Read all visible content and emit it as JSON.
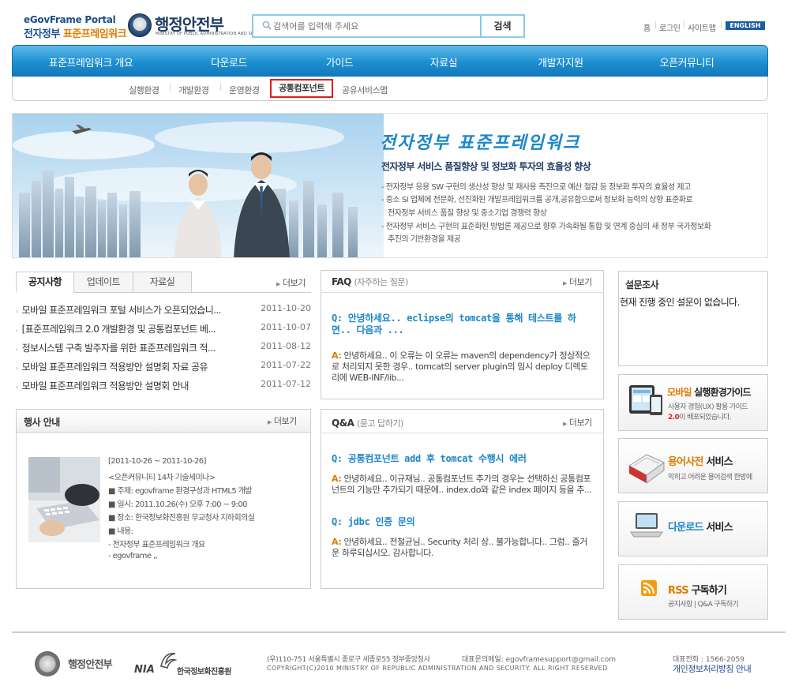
{
  "header": {
    "logo_en": "eGovFrame Portal",
    "logo_kr_prefix": "전자정부",
    "logo_kr_highlight": "표준프레임워크",
    "ministry": "행정안전부",
    "ministry_en": "MINISTRY OF PUBLIC ADMINISTRATION AND SECURITY",
    "search_placeholder": "검색어를 입력해 주세요",
    "search_button": "검색",
    "util_links": [
      "홈",
      "로그인",
      "사이트맵"
    ],
    "english_button": "ENGLISH"
  },
  "nav": {
    "main": [
      "표준프레임워크 개요",
      "다운로드",
      "가이드",
      "자료실",
      "개발자지원",
      "오픈커뮤니티"
    ],
    "sub": [
      "실행환경",
      "개발환경",
      "운영환경",
      "공통컴포넌트",
      "공유서비스맵"
    ],
    "sub_active_index": 3
  },
  "banner": {
    "title": "전자정부 표준프레임워크",
    "subtitle": "전자정부 서비스 품질향상 및 정보화 투자의 효율성 향상",
    "lines": [
      "- 전자정부 응용 SW 구현의 생산성 향상 및 재사용 촉진으로 예산 절감 등 정보화 투자의 효율성 제고",
      "- 중소 SI 업체에 전문화, 선진화된 개발프레임워크를 공개,공유함으로써 정보화 능력의 상향 표준화로",
      "  전자정부 서비스 품질 향상 및 중소기업 경쟁력 향상",
      "- 전자정부 서비스 구현의 표준화된 방법론 제공으로 향후 가속화될 통합 및 연계 중심의 새 정부 국가정보화",
      "  추진의 기반환경을 제공"
    ]
  },
  "notice": {
    "tabs": [
      "공지사항",
      "업데이트",
      "자료실"
    ],
    "more": "더보기",
    "items": [
      {
        "title": "모바일 표준프레임워크 포털 서비스가 오픈되었습니...",
        "date": "2011-10-20"
      },
      {
        "title": "[표준프레임워크 2.0 개발환경 및 공통컴포넌트 베...",
        "date": "2011-10-07"
      },
      {
        "title": "정보시스템 구축 발주자를 위한 표준프레임워크 적...",
        "date": "2011-08-12"
      },
      {
        "title": "모바일 표준프레임워크 적용방안 설명회 자료 공유",
        "date": "2011-07-22"
      },
      {
        "title": "모바일 표준프레임워크 적용방안 설명회 안내",
        "date": "2011-07-12"
      }
    ]
  },
  "event": {
    "title": "행사 안내",
    "more": "더보기",
    "lines": [
      "[2011-10-26 ~ 2011-10-26]",
      "<오픈커뮤니티 14차 기술세미나>",
      "■ 주제: egovframe 환경구성과 HTML5 개발",
      "■ 일시: 2011.10.26(수) 오후 7:00 ~ 9:00",
      "■ 장소: 한국정보화진흥원 무교청사 지하회의실",
      "■ 내용:",
      "- 전자정부 표준프레임워크 개요",
      "- egovframe ,,"
    ]
  },
  "faq": {
    "title": "FAQ",
    "title_sub": "(자주하는 질문)",
    "more": "더보기",
    "q_label": "Q:",
    "a_label": "A:",
    "question": "안녕하세요.. eclipse의 tomcat을 통해 테스트를 하면.. 다음과 ...",
    "answer": "안녕하세요.. 이 오류는 이 오류는 maven의 dependency가 정상적으로 처리되지 못한 경우.. tomcat의 server plugin의 임시 deploy 디렉토리에 WEB-INF/lib..."
  },
  "qna": {
    "title": "Q&A",
    "title_sub": "(묻고 답하기)",
    "more": "더보기",
    "q_label": "Q:",
    "a_label": "A:",
    "items": [
      {
        "q": "공통컴포넌트 add 후 tomcat 수행시 에러",
        "a": "안녕하세요.. 이규재님.. 공통컴포넌트 추가의 경우는 선택하신 공통컴포넌트의 기능만 추가되기 때문에.. index.do와 같은 index 페이지 등을 추..."
      },
      {
        "q": "jdbc 인증 문의",
        "a": "안녕하세요.. 전철균님.. Security 처리 상.. 불가능합니다.. 그럼.. 즐거운 하루되십시오. 감사합니다."
      }
    ]
  },
  "survey": {
    "title": "설문조사",
    "text": "현재 진행 중인 설문이 없습니다."
  },
  "quick": [
    {
      "title_hl": "모바일",
      "title": " 실행환경가이드",
      "sub1": "사용자 경험(UX) 활용 가이드",
      "sub2": "2.0",
      "sub3": "이 배포되었습니다."
    },
    {
      "title_hl": "용어사전",
      "title": " 서비스",
      "sub1": "막히고 어려운 용어검색 한방에"
    },
    {
      "title_hl": "다운로드",
      "title": " 서비스"
    },
    {
      "title_hl": "RSS",
      "title": " 구독하기",
      "sub1": "공지사항 | Q&A 구독하기"
    }
  ],
  "footer": {
    "ministry": "행정안전부",
    "nia": "NIA",
    "nia_kr": "한국정보화진흥원",
    "address": "(우)110-751 서울특별시 종로구 세종로55 정부중앙청사",
    "email": "대표문의메일: egovframesupport@gmail.com",
    "phone": "대표전화 : 1566-2059",
    "copyright": "COPYRIGHT(C)2010 MINISTRY OF REPUBLIC ADMINISTRATION AND SECURITY. ALL RIGHT RESERVED",
    "privacy": "개인정보처리방침 안내"
  },
  "colors": {
    "nav_blue": "#1d8fd0",
    "accent_orange": "#e07a00",
    "link_blue": "#1b86c9",
    "active_red": "#e01d1d"
  }
}
